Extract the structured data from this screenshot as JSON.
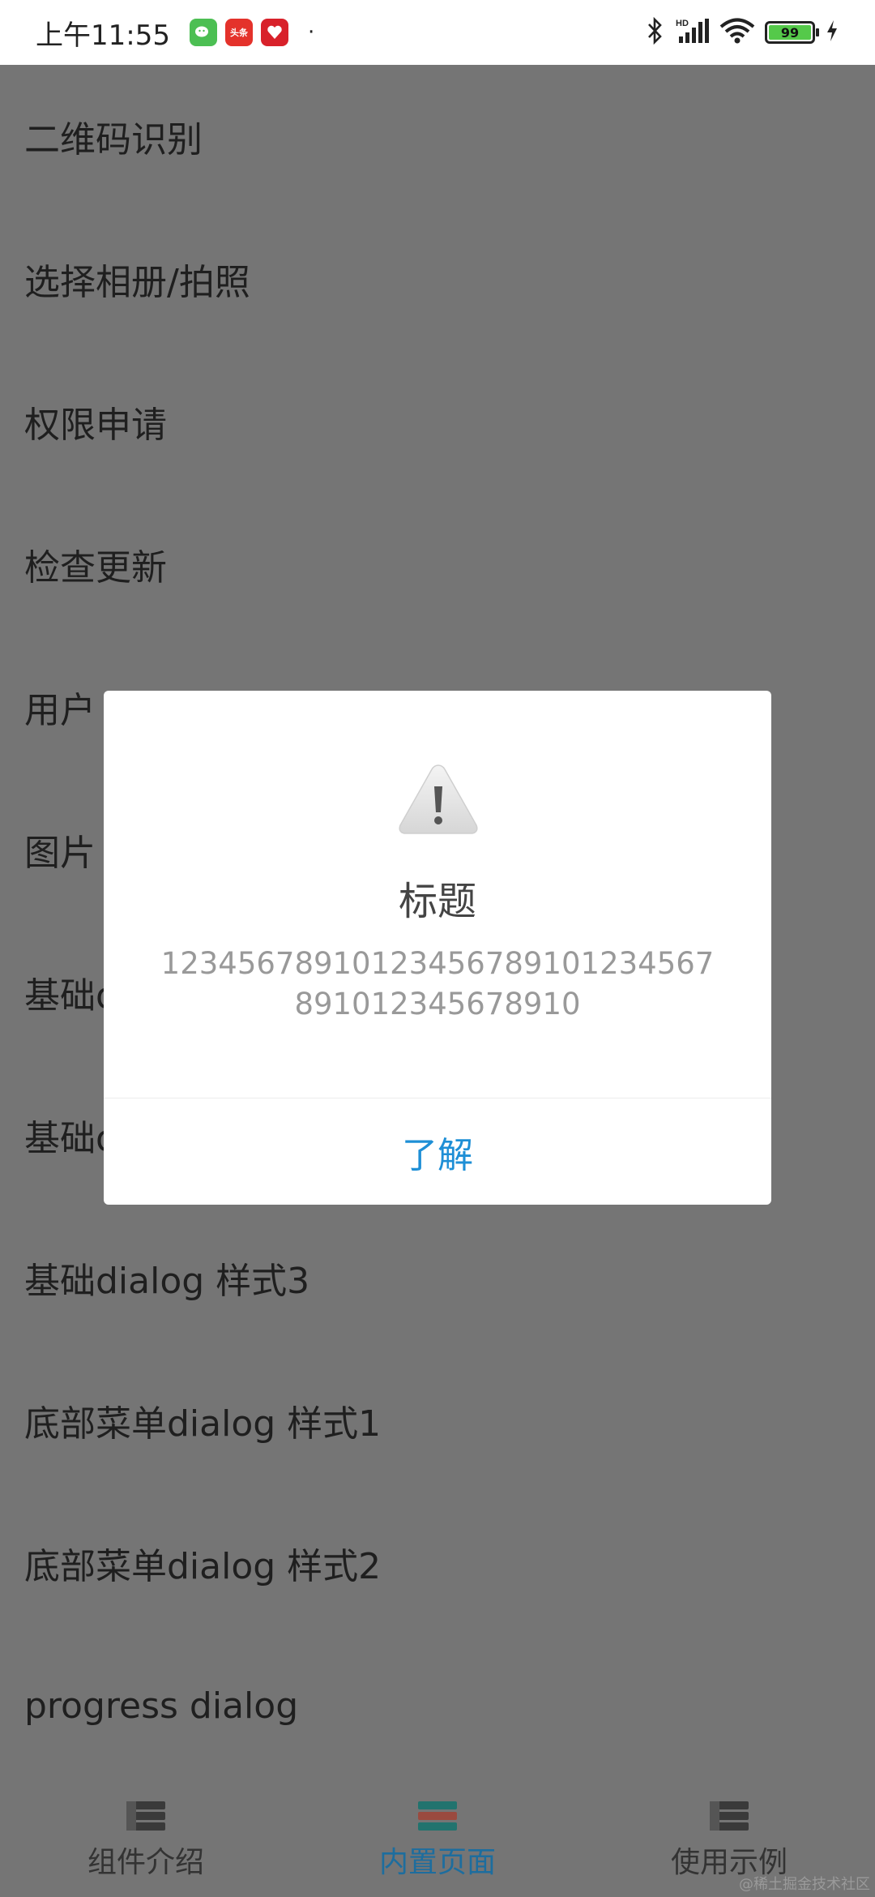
{
  "status_bar": {
    "time": "上午11:55",
    "badges": [
      "wechat-icon",
      "toutiao-icon",
      "pinduoduo-icon"
    ],
    "toutiao_text": "头条",
    "dot": "·",
    "battery": "99"
  },
  "list": {
    "items": [
      "二维码识别",
      "选择相册/拍照",
      "权限申请",
      "检查更新",
      "用户",
      "图片",
      "基础d",
      "基础d",
      "基础dialog 样式3",
      "底部菜单dialog 样式1",
      "底部菜单dialog 样式2",
      "progress dialog"
    ]
  },
  "dialog": {
    "icon": "warning-icon",
    "title": "标题",
    "message": "12345678910123456789101234567891012345678910",
    "button": "了解"
  },
  "bottom_nav": {
    "tabs": [
      {
        "label": "组件介绍",
        "icon": "list-icon"
      },
      {
        "label": "内置页面",
        "icon": "list-icon-colored",
        "active": true
      },
      {
        "label": "使用示例",
        "icon": "list-icon"
      }
    ]
  },
  "watermark": "@稀土掘金技术社区",
  "colors": {
    "overlay": "#757575",
    "accent": "#1e8fd6",
    "active_tab": "#1d6d9e"
  }
}
